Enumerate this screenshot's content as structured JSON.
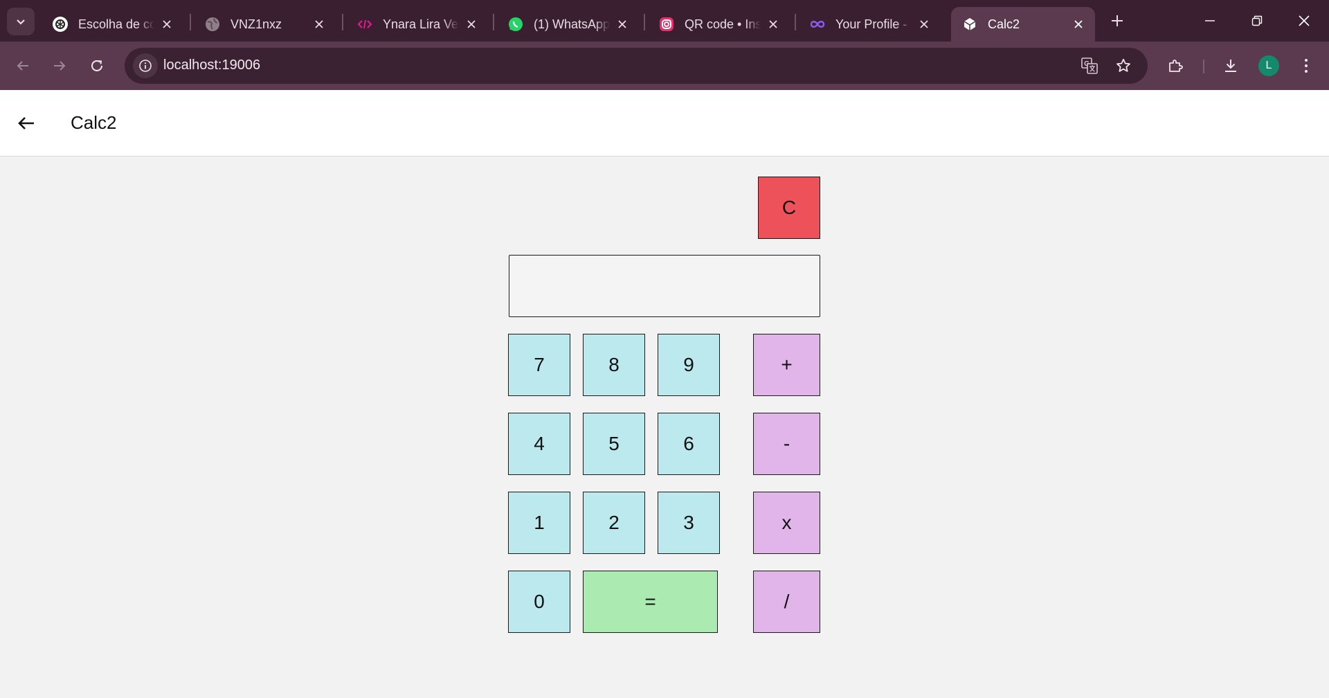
{
  "browser": {
    "tabs": [
      {
        "title": "Escolha de co",
        "icon": "chatgpt-icon"
      },
      {
        "title": "VNZ1nxz",
        "icon": "globe-icon"
      },
      {
        "title": "Ynara Lira Ven",
        "icon": "code-icon"
      },
      {
        "title": "(1) WhatsApp",
        "icon": "whatsapp-icon"
      },
      {
        "title": "QR code • Inst",
        "icon": "instagram-icon"
      },
      {
        "title": "Your Profile - ",
        "icon": "infinity-icon"
      },
      {
        "title": "Calc2",
        "icon": "flutter-icon",
        "active": true
      }
    ],
    "url": "localhost:19006",
    "profile_initial": "L",
    "accent_color": "#5b3a50"
  },
  "app": {
    "title": "Calc2",
    "display_value": "",
    "clear_label": "C",
    "digits": {
      "d7": "7",
      "d8": "8",
      "d9": "9",
      "d4": "4",
      "d5": "5",
      "d6": "6",
      "d1": "1",
      "d2": "2",
      "d3": "3",
      "d0": "0"
    },
    "operators": {
      "add": "+",
      "subtract": "-",
      "multiply": "x",
      "divide": "/"
    },
    "equals_label": "=",
    "colors": {
      "digit": "#bbe9ee",
      "operator": "#e2b5ea",
      "equals": "#abeab0",
      "clear": "#ed525b"
    }
  }
}
